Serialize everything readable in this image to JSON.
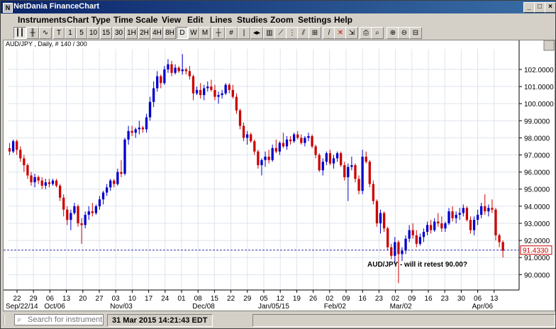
{
  "window": {
    "title": "NetDania FinanceChart",
    "minimize": "_",
    "maximize": "□",
    "close": "×"
  },
  "menu": [
    "Instruments",
    "Chart Type",
    "Time Scale",
    "View",
    "Edit",
    "Lines",
    "Studies",
    "Zoom",
    "Settings",
    "Help"
  ],
  "toolbar": {
    "periods": [
      "T",
      "1",
      "5",
      "10",
      "15",
      "30",
      "1H",
      "2H",
      "4H",
      "8H",
      "D",
      "W",
      "M"
    ],
    "active_period": "D"
  },
  "status": {
    "search_placeholder": "Search for instrument",
    "timestamp": "31 Mar 2015 14:21:43 EDT"
  },
  "chart_data": {
    "type": "candlestick",
    "header": "AUD/JPY , Daily, # 140 / 300",
    "annotation": "AUD/JPY - will it retest 90.00?",
    "current_price": "91.4330",
    "current_value": 91.433,
    "ylim": [
      89.1,
      103.2
    ],
    "y_ticks": [
      90,
      91,
      92,
      93,
      94,
      95,
      96,
      97,
      98,
      99,
      100,
      101,
      102
    ],
    "y_tick_labels": [
      "90.0000",
      "91.0000",
      "92.0000",
      "93.0000",
      "94.0000",
      "95.0000",
      "96.0000",
      "97.0000",
      "98.0000",
      "99.0000",
      "100.0000",
      "101.0000",
      "102.0000"
    ],
    "x_day_labels": [
      "22",
      "29",
      "06",
      "13",
      "20",
      "27",
      "03",
      "10",
      "17",
      "24",
      "01",
      "08",
      "15",
      "22",
      "29",
      "05",
      "12",
      "19",
      "26",
      "02",
      "09",
      "16",
      "23",
      "02",
      "09",
      "16",
      "23",
      "30",
      "06",
      "13"
    ],
    "x_month_labels": [
      {
        "label": "Sep/22/14",
        "index": 0
      },
      {
        "label": "Oct/06",
        "index": 2
      },
      {
        "label": "Nov/03",
        "index": 6
      },
      {
        "label": "Dec/08",
        "index": 11
      },
      {
        "label": "Jan/05/15",
        "index": 15
      },
      {
        "label": "Feb/02",
        "index": 19
      },
      {
        "label": "Mar/02",
        "index": 23
      },
      {
        "label": "Apr/06",
        "index": 28
      }
    ],
    "colors": {
      "up": "#0000cc",
      "down": "#cc0000",
      "grid": "#dde4ee",
      "current_line": "#3333aa"
    },
    "candles": [
      [
        97.4,
        97.7,
        97.0,
        97.2
      ],
      [
        97.2,
        97.9,
        97.1,
        97.8
      ],
      [
        97.8,
        97.9,
        97.0,
        97.3
      ],
      [
        97.3,
        97.5,
        96.6,
        96.8
      ],
      [
        96.8,
        97.0,
        96.0,
        96.4
      ],
      [
        96.4,
        96.5,
        95.6,
        95.8
      ],
      [
        95.8,
        96.0,
        95.2,
        95.4
      ],
      [
        95.4,
        95.9,
        95.1,
        95.7
      ],
      [
        95.7,
        95.8,
        95.3,
        95.5
      ],
      [
        95.5,
        95.7,
        95.0,
        95.2
      ],
      [
        95.2,
        95.6,
        95.0,
        95.4
      ],
      [
        95.4,
        95.6,
        95.1,
        95.3
      ],
      [
        95.3,
        95.6,
        95.2,
        95.5
      ],
      [
        95.5,
        95.6,
        95.1,
        95.2
      ],
      [
        95.2,
        95.3,
        94.3,
        94.5
      ],
      [
        94.5,
        94.7,
        93.4,
        93.8
      ],
      [
        93.8,
        94.0,
        92.9,
        93.2
      ],
      [
        93.2,
        93.8,
        92.6,
        93.6
      ],
      [
        93.6,
        94.2,
        93.5,
        94.0
      ],
      [
        94.0,
        94.1,
        92.8,
        93.0
      ],
      [
        93.0,
        93.3,
        91.8,
        92.9
      ],
      [
        92.9,
        93.7,
        92.7,
        93.5
      ],
      [
        93.5,
        94.0,
        93.2,
        93.7
      ],
      [
        93.7,
        94.2,
        93.4,
        93.6
      ],
      [
        93.6,
        94.1,
        93.5,
        94.0
      ],
      [
        94.0,
        94.6,
        93.8,
        94.4
      ],
      [
        94.4,
        94.9,
        94.1,
        94.8
      ],
      [
        94.8,
        95.3,
        94.6,
        95.1
      ],
      [
        95.1,
        95.6,
        94.9,
        95.5
      ],
      [
        95.5,
        95.6,
        95.1,
        95.3
      ],
      [
        95.3,
        96.2,
        95.2,
        96.0
      ],
      [
        96.0,
        96.7,
        95.7,
        95.9
      ],
      [
        95.9,
        98.0,
        95.8,
        97.9
      ],
      [
        97.9,
        98.7,
        97.6,
        98.4
      ],
      [
        98.4,
        98.7,
        98.1,
        98.3
      ],
      [
        98.3,
        98.6,
        98.0,
        98.5
      ],
      [
        98.5,
        99.0,
        98.2,
        98.6
      ],
      [
        98.6,
        98.7,
        98.3,
        98.5
      ],
      [
        98.5,
        99.4,
        98.3,
        99.2
      ],
      [
        99.2,
        100.4,
        99.0,
        100.1
      ],
      [
        100.1,
        101.3,
        99.8,
        100.9
      ],
      [
        100.9,
        101.9,
        100.7,
        101.6
      ],
      [
        101.6,
        101.7,
        100.9,
        101.2
      ],
      [
        101.2,
        102.2,
        101.1,
        102.0
      ],
      [
        102.0,
        102.6,
        101.8,
        102.3
      ],
      [
        102.3,
        102.5,
        101.6,
        101.8
      ],
      [
        101.8,
        102.3,
        101.7,
        102.1
      ],
      [
        102.1,
        102.2,
        101.8,
        101.9
      ],
      [
        101.9,
        102.9,
        101.7,
        102.0
      ],
      [
        102.0,
        102.1,
        101.7,
        101.9
      ],
      [
        101.9,
        102.2,
        101.4,
        101.6
      ],
      [
        101.6,
        101.7,
        100.2,
        100.6
      ],
      [
        100.6,
        101.0,
        100.5,
        100.8
      ],
      [
        100.8,
        101.2,
        100.3,
        100.5
      ],
      [
        100.5,
        101.1,
        100.2,
        100.9
      ],
      [
        100.9,
        101.3,
        100.7,
        101.0
      ],
      [
        101.0,
        101.4,
        100.7,
        100.8
      ],
      [
        100.8,
        101.1,
        100.2,
        100.4
      ],
      [
        100.4,
        100.7,
        100.0,
        100.5
      ],
      [
        100.5,
        100.8,
        100.3,
        100.6
      ],
      [
        100.6,
        101.2,
        100.5,
        101.1
      ],
      [
        101.1,
        101.2,
        100.6,
        100.8
      ],
      [
        100.8,
        101.1,
        100.3,
        100.4
      ],
      [
        100.4,
        100.6,
        99.4,
        99.6
      ],
      [
        99.6,
        99.7,
        98.5,
        98.7
      ],
      [
        98.7,
        98.9,
        97.8,
        98.0
      ],
      [
        98.0,
        98.4,
        97.6,
        98.2
      ],
      [
        98.2,
        98.3,
        97.7,
        97.8
      ],
      [
        97.8,
        97.9,
        97.0,
        97.2
      ],
      [
        97.2,
        97.3,
        96.2,
        96.4
      ],
      [
        96.4,
        96.8,
        95.8,
        96.7
      ],
      [
        96.7,
        97.2,
        96.3,
        96.9
      ],
      [
        96.9,
        97.3,
        96.5,
        96.7
      ],
      [
        96.7,
        97.6,
        96.6,
        97.4
      ],
      [
        97.4,
        97.9,
        97.1,
        97.2
      ],
      [
        97.2,
        97.8,
        97.0,
        97.7
      ],
      [
        97.7,
        98.3,
        97.4,
        97.5
      ],
      [
        97.5,
        98.1,
        97.3,
        97.9
      ],
      [
        97.9,
        98.1,
        97.6,
        97.8
      ],
      [
        97.8,
        98.3,
        97.7,
        98.2
      ],
      [
        98.2,
        98.4,
        97.9,
        98.0
      ],
      [
        98.0,
        98.2,
        97.6,
        97.7
      ],
      [
        97.7,
        98.1,
        97.5,
        98.0
      ],
      [
        98.0,
        98.3,
        97.8,
        98.1
      ],
      [
        98.1,
        98.2,
        97.4,
        97.5
      ],
      [
        97.5,
        97.6,
        96.8,
        97.0
      ],
      [
        97.0,
        97.1,
        96.0,
        96.1
      ],
      [
        96.1,
        96.8,
        95.8,
        96.6
      ],
      [
        96.6,
        97.2,
        96.4,
        97.1
      ],
      [
        97.1,
        97.3,
        96.4,
        96.5
      ],
      [
        96.5,
        97.0,
        96.2,
        96.8
      ],
      [
        96.8,
        97.2,
        96.6,
        97.1
      ],
      [
        97.1,
        97.2,
        96.3,
        96.4
      ],
      [
        96.4,
        96.6,
        95.5,
        95.7
      ],
      [
        95.7,
        96.5,
        94.3,
        96.3
      ],
      [
        96.3,
        96.9,
        96.1,
        96.4
      ],
      [
        96.4,
        96.5,
        95.4,
        95.6
      ],
      [
        95.6,
        95.8,
        94.7,
        94.9
      ],
      [
        94.9,
        97.3,
        94.7,
        96.9
      ],
      [
        96.9,
        97.2,
        96.5,
        96.6
      ],
      [
        96.6,
        96.7,
        95.1,
        95.3
      ],
      [
        95.3,
        95.5,
        94.1,
        94.3
      ],
      [
        94.3,
        94.4,
        92.8,
        93.0
      ],
      [
        93.0,
        93.8,
        92.4,
        93.6
      ],
      [
        93.6,
        93.7,
        92.5,
        92.7
      ],
      [
        92.7,
        92.8,
        91.4,
        91.6
      ],
      [
        91.6,
        91.8,
        90.9,
        91.1
      ],
      [
        91.1,
        92.2,
        90.6,
        91.9
      ],
      [
        91.9,
        92.0,
        89.5,
        91.2
      ],
      [
        91.2,
        91.6,
        90.8,
        91.4
      ],
      [
        91.4,
        92.3,
        91.2,
        92.1
      ],
      [
        92.1,
        92.9,
        91.9,
        92.6
      ],
      [
        92.6,
        93.0,
        92.1,
        92.3
      ],
      [
        92.3,
        92.6,
        91.6,
        91.8
      ],
      [
        91.8,
        92.4,
        91.7,
        92.2
      ],
      [
        92.2,
        92.7,
        91.9,
        92.5
      ],
      [
        92.5,
        93.1,
        92.3,
        92.9
      ],
      [
        92.9,
        93.2,
        92.4,
        92.6
      ],
      [
        92.6,
        93.3,
        92.5,
        93.1
      ],
      [
        93.1,
        93.6,
        92.8,
        93.0
      ],
      [
        93.0,
        93.4,
        92.5,
        92.7
      ],
      [
        92.7,
        93.1,
        92.5,
        93.0
      ],
      [
        93.0,
        93.9,
        92.9,
        93.7
      ],
      [
        93.7,
        94.0,
        93.1,
        93.3
      ],
      [
        93.3,
        93.7,
        93.0,
        93.5
      ],
      [
        93.5,
        93.9,
        93.2,
        93.6
      ],
      [
        93.6,
        94.1,
        93.4,
        93.9
      ],
      [
        93.9,
        94.0,
        93.1,
        93.2
      ],
      [
        93.2,
        93.4,
        92.4,
        92.6
      ],
      [
        92.6,
        93.4,
        92.3,
        93.2
      ],
      [
        93.2,
        93.8,
        92.9,
        93.5
      ],
      [
        93.5,
        94.2,
        93.3,
        94.0
      ],
      [
        94.0,
        94.7,
        93.5,
        93.7
      ],
      [
        93.7,
        94.1,
        93.4,
        93.9
      ],
      [
        93.9,
        94.4,
        93.6,
        93.8
      ],
      [
        93.8,
        93.9,
        92.0,
        92.3
      ],
      [
        92.3,
        92.4,
        91.6,
        91.9
      ],
      [
        91.9,
        92.0,
        91.0,
        91.4
      ]
    ]
  }
}
